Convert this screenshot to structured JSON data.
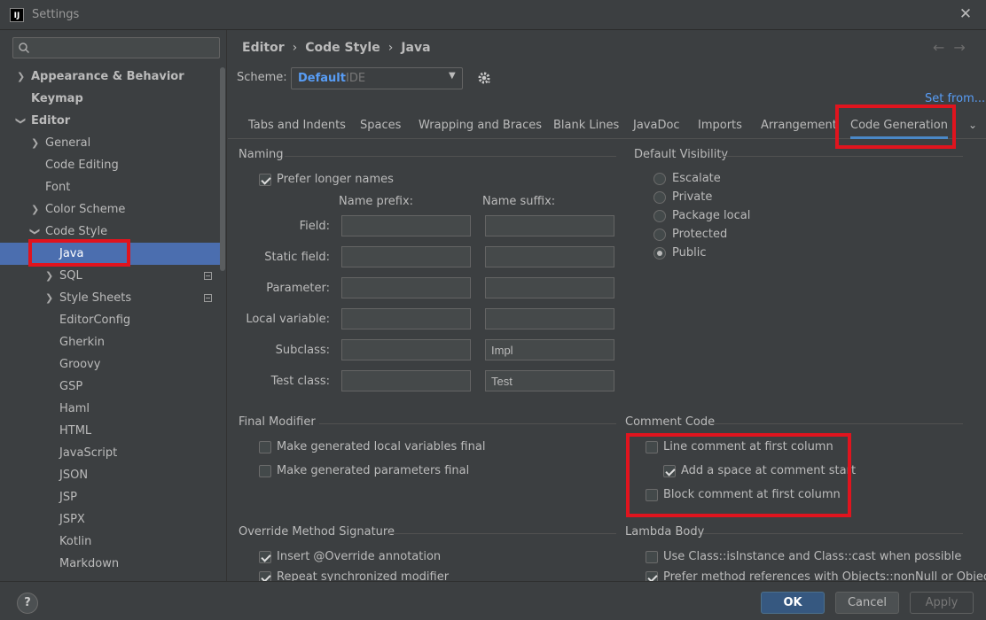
{
  "window": {
    "title": "Settings",
    "app_icon": "IJ"
  },
  "search": {
    "placeholder": ""
  },
  "tree": {
    "items": [
      {
        "label": "Appearance & Behavior"
      },
      {
        "label": "Keymap"
      },
      {
        "label": "Editor"
      },
      {
        "label": "General"
      },
      {
        "label": "Code Editing"
      },
      {
        "label": "Font"
      },
      {
        "label": "Color Scheme"
      },
      {
        "label": "Code Style"
      },
      {
        "label": "Java"
      },
      {
        "label": "SQL"
      },
      {
        "label": "Style Sheets"
      },
      {
        "label": "EditorConfig"
      },
      {
        "label": "Gherkin"
      },
      {
        "label": "Groovy"
      },
      {
        "label": "GSP"
      },
      {
        "label": "Haml"
      },
      {
        "label": "HTML"
      },
      {
        "label": "JavaScript"
      },
      {
        "label": "JSON"
      },
      {
        "label": "JSP"
      },
      {
        "label": "JSPX"
      },
      {
        "label": "Kotlin"
      },
      {
        "label": "Markdown"
      }
    ]
  },
  "breadcrumb": {
    "p1": "Editor",
    "p2": "Code Style",
    "p3": "Java"
  },
  "scheme": {
    "label": "Scheme:",
    "value": "Default",
    "suffix": "IDE",
    "set_from": "Set from..."
  },
  "tabs": [
    {
      "label": "Tabs and Indents"
    },
    {
      "label": "Spaces"
    },
    {
      "label": "Wrapping and Braces"
    },
    {
      "label": "Blank Lines"
    },
    {
      "label": "JavaDoc"
    },
    {
      "label": "Imports"
    },
    {
      "label": "Arrangement"
    },
    {
      "label": "Code Generation"
    }
  ],
  "naming": {
    "title": "Naming",
    "prefer_longer": "Prefer longer names",
    "prefix_header": "Name prefix:",
    "suffix_header": "Name suffix:",
    "rows": [
      {
        "label": "Field:",
        "prefix": "",
        "suffix": ""
      },
      {
        "label": "Static field:",
        "prefix": "",
        "suffix": ""
      },
      {
        "label": "Parameter:",
        "prefix": "",
        "suffix": ""
      },
      {
        "label": "Local variable:",
        "prefix": "",
        "suffix": ""
      },
      {
        "label": "Subclass:",
        "prefix": "",
        "suffix": "Impl"
      },
      {
        "label": "Test class:",
        "prefix": "",
        "suffix": "Test"
      }
    ]
  },
  "visibility": {
    "title": "Default Visibility",
    "options": [
      "Escalate",
      "Private",
      "Package local",
      "Protected",
      "Public"
    ],
    "selected": "Public"
  },
  "final_modifier": {
    "title": "Final Modifier",
    "local_vars": "Make generated local variables final",
    "params": "Make generated parameters final"
  },
  "comment_code": {
    "title": "Comment Code",
    "line_first": "Line comment at first column",
    "add_space": "Add a space at comment start",
    "block_first": "Block comment at first column"
  },
  "override": {
    "title": "Override Method Signature",
    "insert_override": "Insert @Override annotation",
    "repeat_sync": "Repeat synchronized modifier"
  },
  "lambda": {
    "title": "Lambda Body",
    "use_isinstance": "Use Class::isInstance and Class::cast when possible",
    "objects_partial": "Prefer method references with Objects::nonNull or Objects::isNull"
  },
  "buttons": {
    "ok": "OK",
    "cancel": "Cancel",
    "apply": "Apply",
    "help": "?"
  }
}
